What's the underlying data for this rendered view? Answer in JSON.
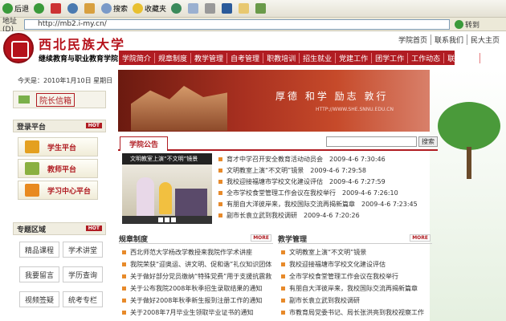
{
  "browser": {
    "back_label": "后退",
    "search_label": "搜索",
    "favorites_label": "收藏夹",
    "address_label": "地址(D)",
    "address_value": "http://mb2.i-my.cn/",
    "go_label": "转到"
  },
  "header": {
    "school_name": "西北民族大学",
    "college_name": "继续教育与职业教育学院",
    "toplinks": [
      "学院首页",
      "联系我们",
      "民大主页"
    ]
  },
  "nav": {
    "items": [
      "学院简介",
      "规章制度",
      "教学管理",
      "自考管理",
      "职教培训",
      "招生就业",
      "党建工作",
      "团学工作",
      "工作动态",
      "联合办学"
    ]
  },
  "banner": {
    "slogan": "厚德 和学 励志 敦行",
    "url": "HTTP://WWW.SHE.SNNU.EDU.CN"
  },
  "sidebar": {
    "date": "今天是：2010年1月10日 星期日",
    "mailbox_label": "院长信箱",
    "platform_title": "登录平台",
    "platform_items": [
      "学生平台",
      "教师平台",
      "学习中心平台"
    ],
    "special_title": "专题区域",
    "special_items": [
      "精品课程",
      "学术讲堂",
      "我要留言",
      "学历查询",
      "视频签疑",
      "统考专栏"
    ],
    "hot_badge": "HOT"
  },
  "announcements": {
    "tab_label": "学院公告",
    "search_button": "搜索",
    "photo_caption": "文明教室上演“不文明”镜景",
    "items": [
      {
        "title": "育才中学召开安全教育活动动员会",
        "date": "2009-4-6 7:30:46"
      },
      {
        "title": "文明教室上演“不文明”镜景",
        "date": "2009-4-6 7:29:58"
      },
      {
        "title": "我校迎接福塘市学校文化建设评估",
        "date": "2009-4-6 7:27:59"
      },
      {
        "title": "全市学校食堂管理工作会议在我校举行",
        "date": "2009-4-6 7:26:10"
      },
      {
        "title": "有朋自大洋彼岸来，我校国际交流再揭新篇章",
        "date": "2009-4-6 7:23:45"
      },
      {
        "title": "副市长袁立武到我校调研",
        "date": "2009-4-6 7:20:26"
      }
    ]
  },
  "rules": {
    "title": "规章制度",
    "more": "MORE",
    "items": [
      "西北师范大学杨改学教授来我院作学术讲座",
      "我院荣获“迎奥运、讲文明、促和谐”礼仪知识团体",
      "关于做好部分党员缴纳“特殊党费”用于支援抗震救",
      "关于公布我院2008年秋季招生录取结果的通知",
      "关于做好2008年秋季新生报到注册工作的通知",
      "关于2008年7月毕业生领取毕业证书的通知"
    ]
  },
  "teaching": {
    "title": "教学管理",
    "more": "MORE",
    "items": [
      "文明教室上演“不文明”镜景",
      "我校迎接福塘市学校文化建设评估",
      "全市学校食堂管理工作会议在我校举行",
      "有朋自大洋彼岸来，我校国际交流再揭新篇章",
      "副市长袁立武到我校调研",
      "市教育局党委书记、局长张洪亮到我校视察工作"
    ]
  }
}
